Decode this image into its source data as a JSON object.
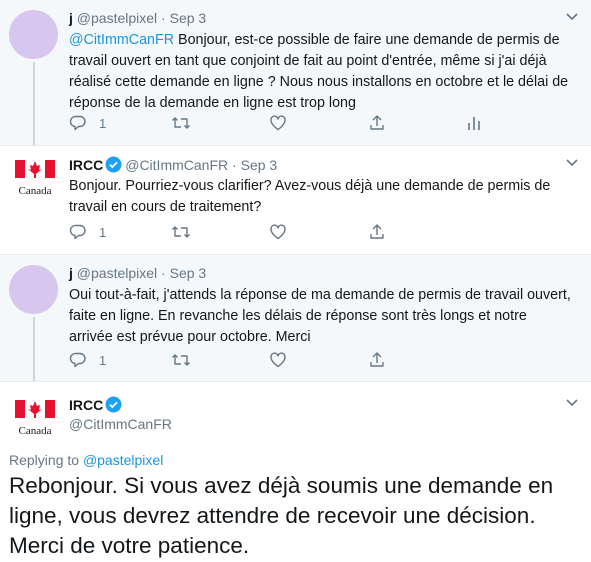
{
  "tweets": [
    {
      "name": "j",
      "handle": "@pastelpixel",
      "dot": "·",
      "date": "Sep 3",
      "mention": "@CitImmCanFR",
      "text": " Bonjour, est-ce possible de faire une demande de permis de travail ouvert en tant que conjoint de fait au point d'entrée, même si j'ai déjà réalisé cette demande en ligne ? Nous nous installons en octobre et le délai de réponse de la demande en ligne est trop long",
      "reply_count": "1"
    },
    {
      "name": "IRCC",
      "handle": "@CitImmCanFR",
      "dot": "·",
      "date": "Sep 3",
      "text": "Bonjour. Pourriez-vous clarifier? Avez-vous déjà une demande de permis de travail en cours de traitement?",
      "reply_count": "1"
    },
    {
      "name": "j",
      "handle": "@pastelpixel",
      "dot": "·",
      "date": "Sep 3",
      "text": "Oui tout-à-fait, j'attends la réponse de ma demande de permis de travail ouvert, faite en ligne. En revanche les délais de réponse sont très longs et notre arrivée est prévue pour octobre. Merci",
      "reply_count": "1"
    }
  ],
  "main_tweet": {
    "name": "IRCC",
    "handle": "@CitImmCanFR",
    "replying_prefix": "Replying to ",
    "replying_to": "@pastelpixel",
    "text": "Rebonjour. Si vous avez déjà soumis une demande en ligne, vous devrez attendre de recevoir une décision. Merci de votre patience."
  },
  "logo": {
    "wordmark": "Canada"
  },
  "colors": {
    "link": "#1b95e0",
    "verified": "#1da1f2",
    "secondary": "#657786",
    "flag_red": "#e8112d"
  },
  "icons": [
    "reply-icon",
    "retweet-icon",
    "like-icon",
    "share-icon",
    "analytics-icon",
    "chevron-down-icon",
    "verified-badge-icon"
  ]
}
